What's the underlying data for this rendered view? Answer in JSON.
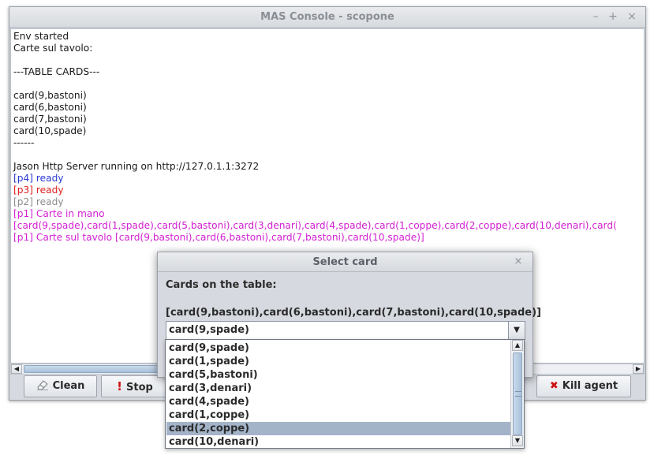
{
  "window": {
    "title": "MAS Console - scopone",
    "controls": {
      "minimize": "–",
      "maximize": "+",
      "close": "×"
    }
  },
  "console": {
    "lines": [
      {
        "text": "Env started",
        "color": "#1a1a1a"
      },
      {
        "text": "Carte sul tavolo:",
        "color": "#1a1a1a"
      },
      {
        "text": "",
        "color": "#1a1a1a"
      },
      {
        "text": "---TABLE CARDS---",
        "color": "#1a1a1a"
      },
      {
        "text": "",
        "color": "#1a1a1a"
      },
      {
        "text": "card(9,bastoni)",
        "color": "#1a1a1a"
      },
      {
        "text": "card(6,bastoni)",
        "color": "#1a1a1a"
      },
      {
        "text": "card(7,bastoni)",
        "color": "#1a1a1a"
      },
      {
        "text": "card(10,spade)",
        "color": "#1a1a1a"
      },
      {
        "text": "------",
        "color": "#1a1a1a"
      },
      {
        "text": "",
        "color": "#1a1a1a"
      },
      {
        "text": "Jason Http Server running on http://127.0.1.1:3272",
        "color": "#1a1a1a"
      },
      {
        "text": "[p4] ready",
        "color": "#2b3bd1"
      },
      {
        "text": "[p3] ready",
        "color": "#e01f1f"
      },
      {
        "text": "[p2] ready",
        "color": "#8c8c8c"
      },
      {
        "text": "[p1] Carte in mano",
        "color": "#d21fd2"
      },
      {
        "text": "[card(9,spade),card(1,spade),card(5,bastoni),card(3,denari),card(4,spade),card(1,coppe),card(2,coppe),card(10,denari),card(",
        "color": "#d21fd2"
      },
      {
        "text": "[p1] Carte sul tavolo [card(9,bastoni),card(6,bastoni),card(7,bastoni),card(10,spade)]",
        "color": "#d21fd2"
      }
    ]
  },
  "buttons": {
    "clean": {
      "label": "Clean",
      "icon": "eraser-icon"
    },
    "stop": {
      "label": "Stop",
      "icon": "exclamation-icon",
      "icon_glyph": "!",
      "icon_color": "#d01010"
    },
    "kill_agent": {
      "label": "Kill agent",
      "icon": "red-x-icon",
      "icon_glyph": "✖",
      "icon_color": "#d01010"
    }
  },
  "dialog": {
    "title": "Select card",
    "close": "×",
    "heading": "Cards on the table:",
    "table_cards": "[card(9,bastoni),card(6,bastoni),card(7,bastoni),card(10,spade)]",
    "combo": {
      "selected": "card(9,spade)",
      "options": [
        "card(9,spade)",
        "card(1,spade)",
        "card(5,bastoni)",
        "card(3,denari)",
        "card(4,spade)",
        "card(1,coppe)",
        "card(2,coppe)",
        "card(10,denari)"
      ],
      "highlighted_index": 6
    }
  },
  "colors": {
    "window_bg": "#d6d9df",
    "selection": "#a3b4c9"
  }
}
